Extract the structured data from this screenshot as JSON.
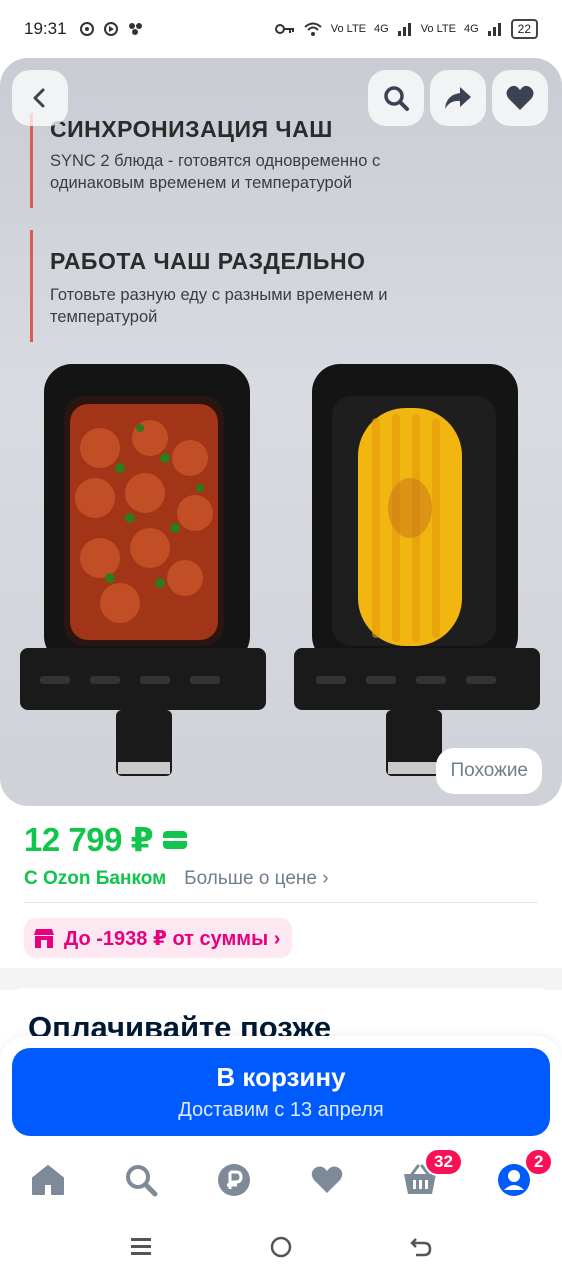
{
  "status_bar": {
    "time": "19:31",
    "battery": "22",
    "network_labels": [
      "Vo LTE",
      "4G",
      "Vo LTE",
      "4G"
    ]
  },
  "hero": {
    "heading_sync": "СИНХРОНИЗАЦИЯ ЧАШ",
    "text_sync": "SYNC  2 блюда - готовятся одновременно с одинаковым временем и температурой",
    "heading_separate": "РАБОТА ЧАШ РАЗДЕЛЬНО",
    "text_separate": "Готовьте разную еду с разными временем и температурой",
    "similar_label": "Похожие"
  },
  "price": {
    "value": "12 799 ₽",
    "bank_label": "С Ozon Банком",
    "more_label": "Больше о цене ›"
  },
  "promo": {
    "label": "До -1938 ₽ от суммы ›"
  },
  "pay_later": {
    "title": "Оплачивайте позже"
  },
  "cart": {
    "label": "В корзину",
    "delivery": "Доставим с 13 апреля"
  },
  "bottom_nav": {
    "cart_badge": "32",
    "profile_badge": "2"
  },
  "colors": {
    "accent_green": "#10c44c",
    "brand_blue": "#005bff",
    "promo_pink": "#e6007e",
    "badge_red": "#f91155"
  }
}
